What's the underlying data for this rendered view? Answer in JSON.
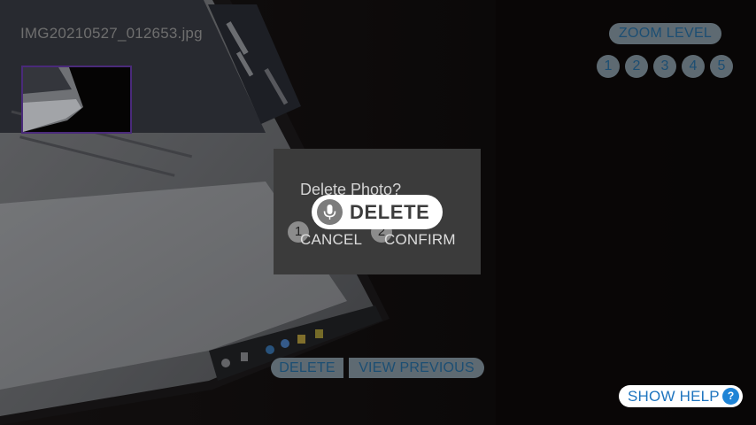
{
  "photo": {
    "filename": "IMG20210527_012653.jpg"
  },
  "zoom": {
    "label": "ZOOM LEVEL",
    "levels": [
      "1",
      "2",
      "3",
      "4",
      "5"
    ]
  },
  "dialog": {
    "title": "Delete Photo?",
    "cancel_number": "1",
    "cancel_label": "CANCEL",
    "confirm_number": "2",
    "confirm_label": "CONFIRM"
  },
  "voice": {
    "icon": "microphone-icon",
    "command": "DELETE"
  },
  "actions": {
    "delete_label": "DELETE",
    "view_previous_label": "VIEW PREVIOUS"
  },
  "help": {
    "label": "SHOW HELP",
    "icon_glyph": "?"
  },
  "colors": {
    "pill_bg": "#5e6a72",
    "pill_text": "#1c4e73",
    "help_accent": "#1f84d6",
    "dialog_bg": "#3b3b3b",
    "thumb_border": "#4a2a7a"
  }
}
